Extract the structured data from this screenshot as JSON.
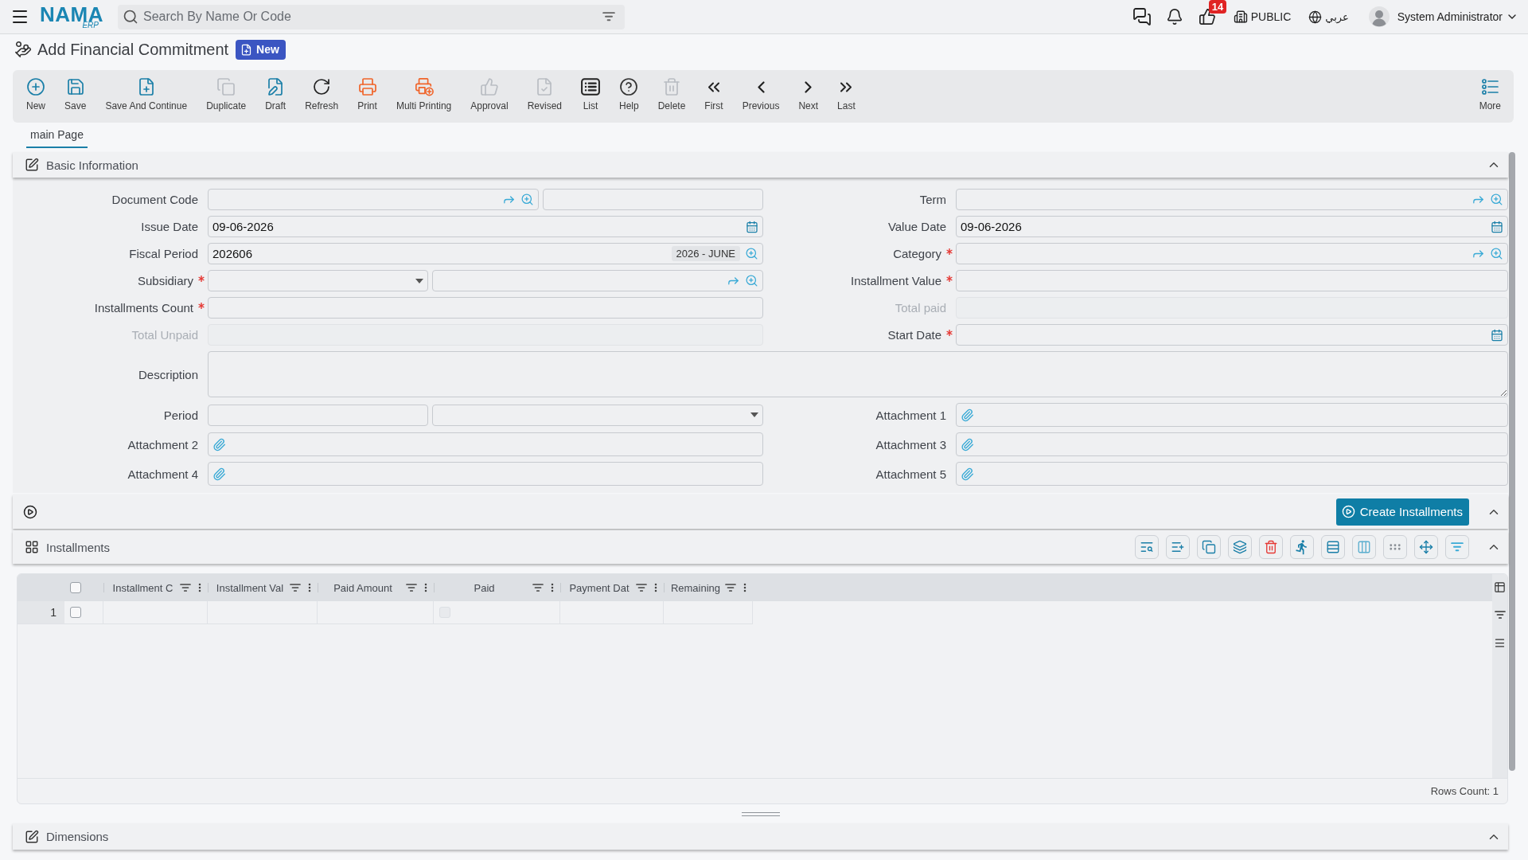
{
  "top_bar": {
    "logo": {
      "name": "NAMA",
      "suffix": "ERP"
    },
    "search": {
      "placeholder": "Search By Name Or Code"
    },
    "likes_count": "14",
    "company": "PUBLIC",
    "language": "عربي",
    "user": "System Administrator"
  },
  "page": {
    "title": "Add Financial Commitment",
    "status": "New"
  },
  "toolbar": {
    "buttons": [
      {
        "label": "New",
        "disabled": false
      },
      {
        "label": "Save",
        "disabled": false
      },
      {
        "label": "Save And Continue",
        "disabled": false
      },
      {
        "label": "Duplicate",
        "disabled": true
      },
      {
        "label": "Draft",
        "disabled": false
      },
      {
        "label": "Refresh",
        "disabled": false
      },
      {
        "label": "Print",
        "disabled": false
      },
      {
        "label": "Multi Printing",
        "disabled": false
      },
      {
        "label": "Approval",
        "disabled": true
      },
      {
        "label": "Revised",
        "disabled": true
      },
      {
        "label": "List",
        "disabled": false
      },
      {
        "label": "Help",
        "disabled": false
      },
      {
        "label": "Delete",
        "disabled": true
      },
      {
        "label": "First",
        "disabled": false
      },
      {
        "label": "Previous",
        "disabled": false
      },
      {
        "label": "Next",
        "disabled": false
      },
      {
        "label": "Last",
        "disabled": false
      }
    ],
    "more": "More"
  },
  "tabs": [
    {
      "label": "main Page",
      "selected": true
    }
  ],
  "basic_information": {
    "title": "Basic Information",
    "expanded": true,
    "fields": [
      {
        "label": "Document Code",
        "kind": "lookup_pair",
        "required": false,
        "disabled": false
      },
      {
        "label": "Term",
        "kind": "lookup",
        "required": false,
        "disabled": false
      },
      {
        "label": "Issue Date",
        "kind": "date",
        "required": false,
        "disabled": false,
        "value": "09-06-2026"
      },
      {
        "label": "Value Date",
        "kind": "date",
        "required": false,
        "disabled": false,
        "value": "09-06-2026"
      },
      {
        "label": "Fiscal Period",
        "kind": "period",
        "required": false,
        "disabled": false,
        "value": "202606",
        "tag": "2026 - JUNE"
      },
      {
        "label": "Category",
        "kind": "lookup",
        "required": true,
        "disabled": false
      },
      {
        "label": "Subsidiary",
        "kind": "select_lookup",
        "required": true,
        "disabled": false
      },
      {
        "label": "Installment Value",
        "kind": "text",
        "required": true,
        "disabled": false
      },
      {
        "label": "Installments Count",
        "kind": "text",
        "required": true,
        "disabled": false
      },
      {
        "label": "Total paid",
        "kind": "text",
        "required": false,
        "disabled": true
      },
      {
        "label": "Total Unpaid",
        "kind": "text",
        "required": false,
        "disabled": true
      },
      {
        "label": "Start Date",
        "kind": "date",
        "required": true,
        "disabled": false
      },
      {
        "label": "Description",
        "kind": "textarea",
        "required": false,
        "disabled": false
      },
      {
        "label": "Period",
        "kind": "text_select",
        "required": false,
        "disabled": false
      },
      {
        "label": "Attachment 1",
        "kind": "attachment",
        "required": false,
        "disabled": false
      },
      {
        "label": "Attachment 2",
        "kind": "attachment",
        "required": false,
        "disabled": false
      },
      {
        "label": "Attachment 3",
        "kind": "attachment",
        "required": false,
        "disabled": false
      },
      {
        "label": "Attachment 4",
        "kind": "attachment",
        "required": false,
        "disabled": false
      },
      {
        "label": "Attachment 5",
        "kind": "attachment",
        "required": false,
        "disabled": false
      }
    ]
  },
  "action_bar": {
    "button": "Create Installments",
    "expanded": true
  },
  "installments": {
    "title": "Installments",
    "expanded": true,
    "table": {
      "all_selected": false,
      "columns": [
        {
          "label": "Installment C",
          "kind": "text"
        },
        {
          "label": "Installment Val",
          "kind": "text"
        },
        {
          "label": "Paid Amount",
          "kind": "text"
        },
        {
          "label": "Paid",
          "kind": "check"
        },
        {
          "label": "Payment Dat",
          "kind": "text"
        },
        {
          "label": "Remaining",
          "kind": "text"
        }
      ],
      "rows": [
        {
          "number": "1",
          "selected": false,
          "paid": false
        }
      ]
    },
    "rows_count": "Rows Count: 1"
  },
  "dimensions": {
    "title": "Dimensions",
    "expanded": true
  }
}
